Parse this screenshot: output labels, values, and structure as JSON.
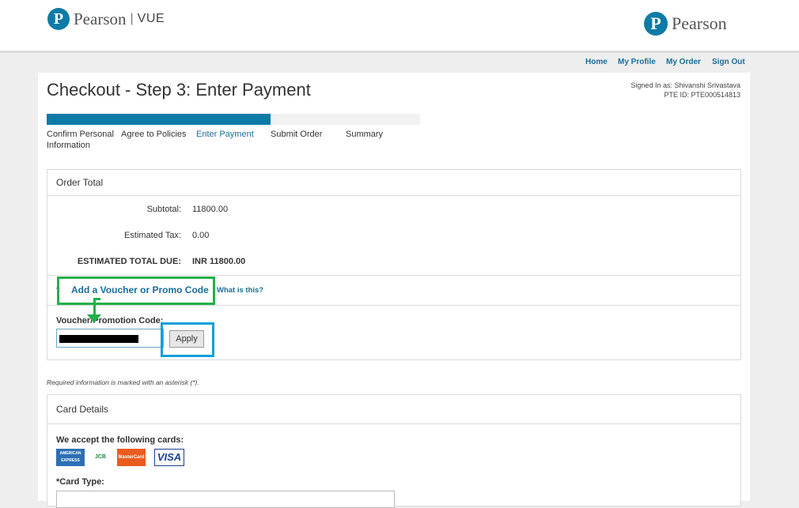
{
  "header": {
    "brand_left": "Pearson",
    "brand_left_separator": "|",
    "brand_left_sub": "VUE",
    "brand_right": "Pearson",
    "logo_letter": "P"
  },
  "nav": {
    "home": "Home",
    "my_profile": "My Profile",
    "my_order": "My Order",
    "sign_out": "Sign Out"
  },
  "page": {
    "title": "Checkout - Step 3: Enter Payment",
    "signed_in": "Signed In as: Shivanshi Srivastava",
    "pte_id": "PTE ID: PTE000514813"
  },
  "progress": {
    "fraction": 0.6,
    "steps": [
      {
        "label": "Confirm Personal",
        "label2": "Information"
      },
      {
        "label": "Agree to Policies"
      },
      {
        "label": "Enter Payment"
      },
      {
        "label": "Submit Order"
      },
      {
        "label": "Summary"
      }
    ]
  },
  "order_total": {
    "heading": "Order Total",
    "subtotal_label": "Subtotal:",
    "subtotal_value": "11800.00",
    "tax_label": "Estimated Tax:",
    "tax_value": "0.00",
    "total_label": "ESTIMATED TOTAL DUE:",
    "total_value": "INR 11800.00"
  },
  "voucher": {
    "caret": "^",
    "link": "Add a Voucher or Promo Code",
    "what_is": "What is this?",
    "field_label": "Voucher/Promotion Code:",
    "apply": "Apply"
  },
  "note": "Required information is marked with an asterisk (*).",
  "card": {
    "heading": "Card Details",
    "accept": "We accept the following cards:",
    "logos": [
      {
        "name": "AMERICAN EXPRESS",
        "color": "#2b6fb6"
      },
      {
        "name": "JCB",
        "color": "#1b8a3e"
      },
      {
        "name": "MasterCard",
        "color": "#eb5b1e"
      },
      {
        "name": "VISA",
        "color": "#1a3f92"
      }
    ],
    "card_type_label": "*Card Type:"
  },
  "colors": {
    "accent": "#0d7ba6",
    "link": "#1a6e9c",
    "highlight_green": "#22b04a",
    "highlight_blue": "#139fdb"
  }
}
